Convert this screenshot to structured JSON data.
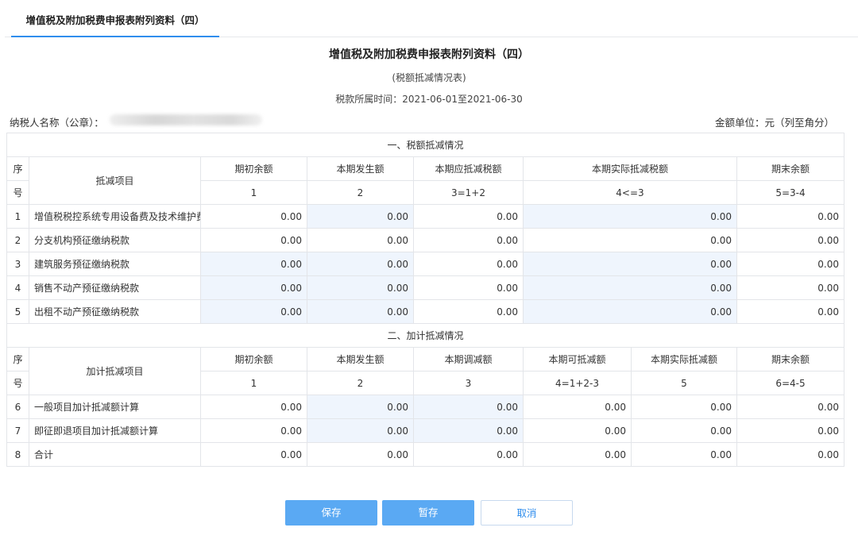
{
  "tab": {
    "label": "增值税及附加税费申报表附列资料（四）"
  },
  "header": {
    "title": "增值税及附加税费申报表附列资料（四）",
    "subtitle": "(税额抵减情况表)",
    "period_label": "税款所属时间：",
    "period_value": "2021-06-01至2021-06-30",
    "taxpayer_label": "纳税人名称（公章）：",
    "unit": "金额单位：元（列至角分）"
  },
  "section1": {
    "title": "一、税额抵减情况",
    "seq_header_top": "序",
    "seq_header_bottom": "号",
    "item_header": "抵减项目",
    "columns": [
      "期初余额",
      "本期发生额",
      "本期应抵减税额",
      "本期实际抵减税额",
      "期末余额"
    ],
    "formulas": [
      "1",
      "2",
      "3=1+2",
      "4<=3",
      "5=3-4"
    ],
    "rows": [
      {
        "seq": "1",
        "name": "增值税税控系统专用设备费及技术维护费",
        "values": [
          "0.00",
          "0.00",
          "0.00",
          "0.00",
          "0.00"
        ]
      },
      {
        "seq": "2",
        "name": "分支机构预征缴纳税款",
        "values": [
          "0.00",
          "0.00",
          "0.00",
          "0.00",
          "0.00"
        ]
      },
      {
        "seq": "3",
        "name": "建筑服务预征缴纳税款",
        "values": [
          "0.00",
          "0.00",
          "0.00",
          "0.00",
          "0.00"
        ]
      },
      {
        "seq": "4",
        "name": "销售不动产预征缴纳税款",
        "values": [
          "0.00",
          "0.00",
          "0.00",
          "0.00",
          "0.00"
        ]
      },
      {
        "seq": "5",
        "name": "出租不动产预征缴纳税款",
        "values": [
          "0.00",
          "0.00",
          "0.00",
          "0.00",
          "0.00"
        ]
      }
    ]
  },
  "section2": {
    "title": "二、加计抵减情况",
    "seq_header_top": "序",
    "seq_header_bottom": "号",
    "item_header": "加计抵减项目",
    "columns": [
      "期初余额",
      "本期发生额",
      "本期调减额",
      "本期可抵减额",
      "本期实际抵减额",
      "期末余额"
    ],
    "formulas": [
      "1",
      "2",
      "3",
      "4=1+2-3",
      "5",
      "6=4-5"
    ],
    "rows": [
      {
        "seq": "6",
        "name": "一般项目加计抵减额计算",
        "values": [
          "0.00",
          "0.00",
          "0.00",
          "0.00",
          "0.00",
          "0.00"
        ]
      },
      {
        "seq": "7",
        "name": "即征即退项目加计抵减额计算",
        "values": [
          "0.00",
          "0.00",
          "0.00",
          "0.00",
          "0.00",
          "0.00"
        ]
      },
      {
        "seq": "8",
        "name": "合计",
        "values": [
          "0.00",
          "0.00",
          "0.00",
          "0.00",
          "0.00",
          "0.00"
        ]
      }
    ]
  },
  "buttons": {
    "save": "保存",
    "temp_save": "暂存",
    "cancel": "取消"
  },
  "colors": {
    "accent": "#2f8ded",
    "editable_bg": "#eff5fd",
    "editable_text": "#2b8be0",
    "button_primary": "#5aa9f3"
  }
}
